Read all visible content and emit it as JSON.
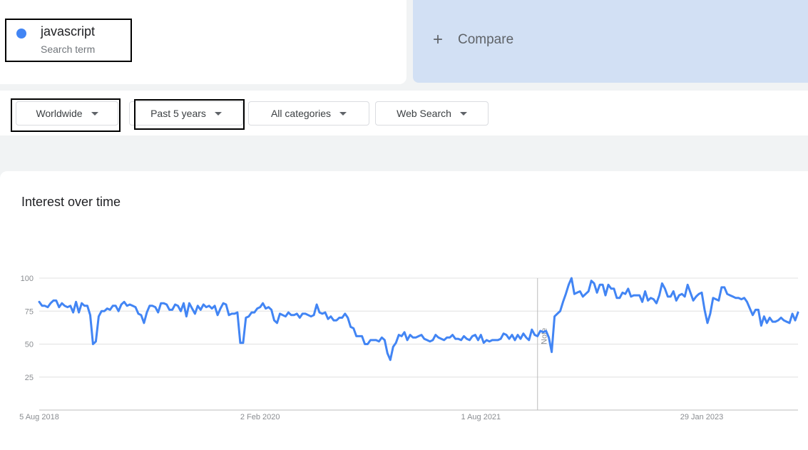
{
  "search_term": {
    "name": "javascript",
    "subtitle": "Search term",
    "color": "#4285f4"
  },
  "compare": {
    "plus": "+",
    "label": "Compare"
  },
  "filters": {
    "region": "Worldwide",
    "time_range": "Past 5 years",
    "category": "All categories",
    "search_type": "Web Search"
  },
  "chart_title": "Interest over time",
  "chart_note": "Note",
  "chart_data": {
    "type": "line",
    "title": "Interest over time",
    "xlabel": "",
    "ylabel": "",
    "ylim": [
      0,
      100
    ],
    "y_ticks": [
      25,
      50,
      75,
      100
    ],
    "x_ticks": [
      {
        "label": "5 Aug 2018",
        "week": 0
      },
      {
        "label": "2 Feb 2020",
        "week": 78
      },
      {
        "label": "1 Aug 2021",
        "week": 156
      },
      {
        "label": "29 Jan 2023",
        "week": 234
      }
    ],
    "note_week": 176,
    "grid": true,
    "series": [
      {
        "name": "javascript",
        "color": "#4285f4",
        "values": [
          82,
          79,
          79,
          78,
          81,
          83,
          83,
          78,
          81,
          79,
          78,
          79,
          74,
          82,
          74,
          81,
          79,
          79,
          72,
          50,
          52,
          71,
          75,
          75,
          77,
          76,
          79,
          79,
          75,
          80,
          82,
          79,
          80,
          79,
          78,
          73,
          72,
          66,
          74,
          79,
          79,
          78,
          74,
          81,
          81,
          80,
          76,
          76,
          80,
          79,
          75,
          81,
          71,
          81,
          77,
          73,
          79,
          76,
          80,
          78,
          79,
          77,
          79,
          72,
          77,
          81,
          80,
          72,
          73,
          73,
          74,
          51,
          51,
          70,
          71,
          74,
          74,
          77,
          78,
          81,
          77,
          78,
          76,
          68,
          66,
          73,
          72,
          71,
          74,
          72,
          72,
          73,
          70,
          73,
          73,
          72,
          71,
          72,
          80,
          74,
          73,
          74,
          69,
          71,
          68,
          68,
          70,
          70,
          73,
          70,
          63,
          62,
          56,
          56,
          56,
          50,
          50,
          53,
          53,
          53,
          52,
          55,
          53,
          43,
          38,
          48,
          51,
          57,
          56,
          59,
          53,
          57,
          55,
          55,
          56,
          57,
          54,
          53,
          52,
          53,
          57,
          55,
          54,
          53,
          55,
          55,
          57,
          54,
          54,
          53,
          56,
          54,
          53,
          56,
          57,
          53,
          57,
          51,
          53,
          52,
          53,
          53,
          53,
          54,
          58,
          57,
          54,
          57,
          53,
          57,
          54,
          58,
          55,
          53,
          61,
          57,
          56,
          60,
          59,
          60,
          55,
          44,
          71,
          73,
          75,
          82,
          88,
          95,
          100,
          88,
          89,
          90,
          86,
          88,
          90,
          98,
          96,
          89,
          95,
          95,
          87,
          95,
          92,
          92,
          85,
          85,
          89,
          88,
          92,
          86,
          87,
          87,
          87,
          82,
          90,
          83,
          85,
          84,
          81,
          87,
          96,
          92,
          86,
          86,
          90,
          83,
          87,
          88,
          86,
          95,
          89,
          83,
          86,
          88,
          89,
          76,
          66,
          73,
          85,
          84,
          83,
          93,
          93,
          88,
          87,
          86,
          85,
          85,
          84,
          85,
          82,
          77,
          72,
          76,
          76,
          64,
          71,
          66,
          70,
          67,
          67,
          68,
          70,
          68,
          67,
          66,
          73,
          68,
          74
        ]
      }
    ]
  }
}
